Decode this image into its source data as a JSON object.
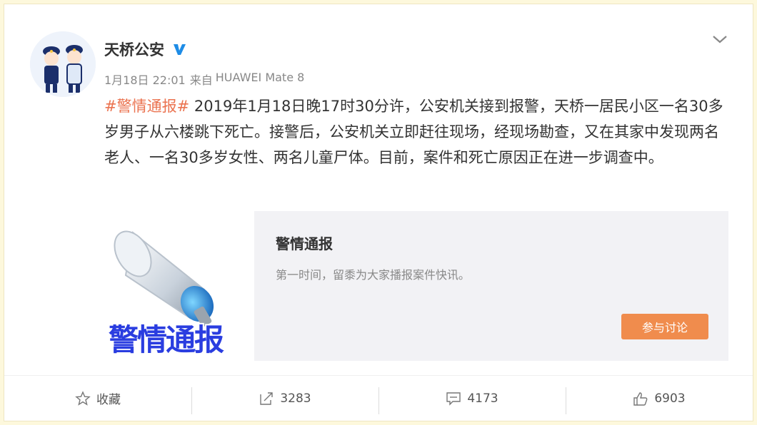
{
  "post": {
    "author_name": "天桥公安",
    "timestamp": "1月18日 22:01",
    "source_prefix": "来自",
    "source": "HUAWEI Mate 8",
    "hashtag": "#警情通报#",
    "text": " 2019年1月18日晚17时30分许，公安机关接到报警，天桥一居民小区一名30多岁男子从六楼跳下死亡。接警后，公安机关立即赶往现场，经现场勘查，又在其家中发现两名老人、一名30多岁女性、两名儿童尸体。目前，案件和死亡原因正在进一步调查中。"
  },
  "link_card": {
    "thumb_caption": "警情通报",
    "title": "警情通报",
    "description": "第一时间，留黍为大家播报案件快讯。",
    "button_label": "参与讨论"
  },
  "actions": {
    "favorite_label": "收藏",
    "repost_count": "3283",
    "comment_count": "4173",
    "like_count": "6903"
  },
  "colors": {
    "accent": "#eb7350",
    "verified": "#1e8ce6",
    "button": "#f08c4d",
    "page_background": "#fdf8dc"
  },
  "icons": [
    "verified-badge-icon",
    "chevron-down-icon",
    "star-icon",
    "repost-icon",
    "comment-icon",
    "thumbs-up-icon"
  ]
}
